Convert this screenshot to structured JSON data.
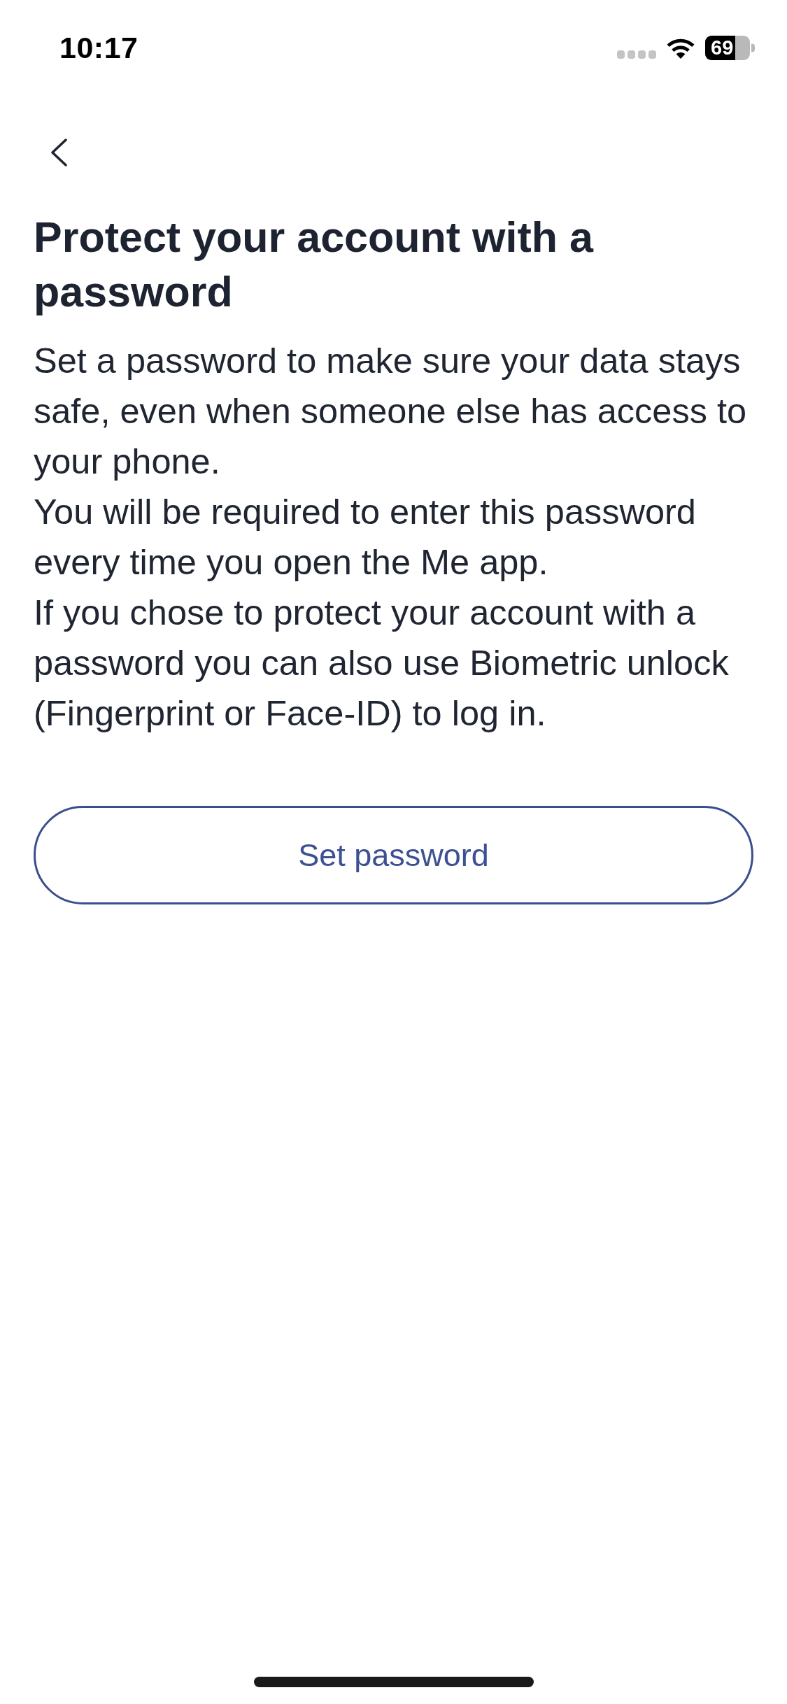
{
  "status_bar": {
    "time": "10:17",
    "battery": "69"
  },
  "title": "Protect your account with a password",
  "paragraphs": [
    "Set a password to make sure your data stays safe, even when someone else has access to your phone.",
    "You will be required to enter this password every time you open the Me app.",
    "If you chose to protect your account with a password you can also use Biometric unlock (Fingerprint or Face-ID) to log in."
  ],
  "button": {
    "label": "Set password"
  }
}
